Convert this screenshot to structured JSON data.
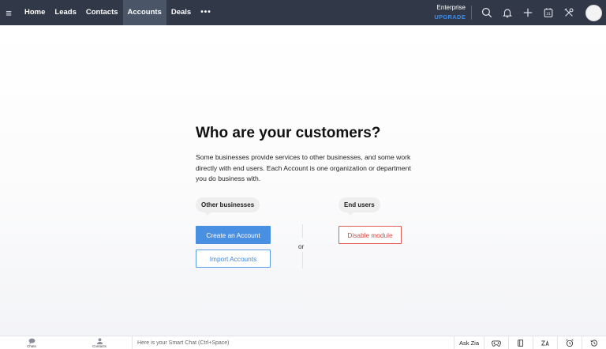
{
  "nav": {
    "tabs": [
      {
        "label": "Home",
        "active": false
      },
      {
        "label": "Leads",
        "active": false
      },
      {
        "label": "Contacts",
        "active": false
      },
      {
        "label": "Accounts",
        "active": true
      },
      {
        "label": "Deals",
        "active": false
      }
    ],
    "more_label": "•••",
    "plan_name": "Enterprise",
    "upgrade_label": "UPGRADE",
    "icons": [
      "search-icon",
      "bell-icon",
      "plus-icon",
      "calendar-icon",
      "tools-icon"
    ]
  },
  "main": {
    "title": "Who are your customers?",
    "description": "Some businesses provide services to other businesses, and some work directly with end users. Each Account is one organization or department you do business with.",
    "other_businesses_label": "Other businesses",
    "end_users_label": "End users",
    "create_account_label": "Create an Account",
    "import_accounts_label": "Import Accounts",
    "or_label": "or",
    "disable_module_label": "Disable module"
  },
  "bottombar": {
    "chats_label": "Chats",
    "contacts_label": "Contacts",
    "smart_chat_placeholder": "Here is your Smart Chat (Ctrl+Space)",
    "ask_zia_label": "Ask Zia",
    "icons": [
      "gamepad-icon",
      "book-icon",
      "translate-icon",
      "alarm-icon",
      "history-icon"
    ]
  },
  "colors": {
    "nav_bg": "#313949",
    "nav_active": "#4a5568",
    "upgrade": "#3b8bea",
    "primary_button": "#4a90e2",
    "danger": "#d24a43"
  }
}
